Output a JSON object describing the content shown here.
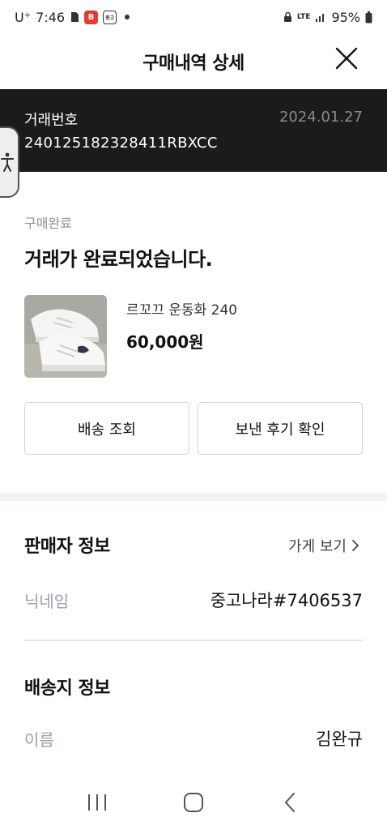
{
  "status_bar": {
    "carrier": "U⁺",
    "time": "7:46",
    "network": "LTE",
    "battery": "95%"
  },
  "header": {
    "title": "구매내역 상세"
  },
  "transaction": {
    "label": "거래번호",
    "number": "240125182328411RBXCC",
    "date": "2024.01.27"
  },
  "order_status": {
    "small": "구매완료",
    "message": "거래가 완료되었습니다."
  },
  "product": {
    "name": "르꼬끄 운동화 240",
    "price": "60,000원"
  },
  "actions": {
    "tracking_label": "배송 조회",
    "review_label": "보낸 후기 확인"
  },
  "seller": {
    "title": "판매자 정보",
    "store_link": "가게 보기",
    "nickname_label": "닉네임",
    "nickname_value": "중고나라#7406537"
  },
  "shipping": {
    "title": "배송지 정보",
    "name_label": "이름",
    "name_value": "김완규"
  },
  "colors": {
    "banner_bg": "#1b1b1b",
    "muted_text": "#9aa0a8",
    "divider": "#f1f3f6"
  }
}
